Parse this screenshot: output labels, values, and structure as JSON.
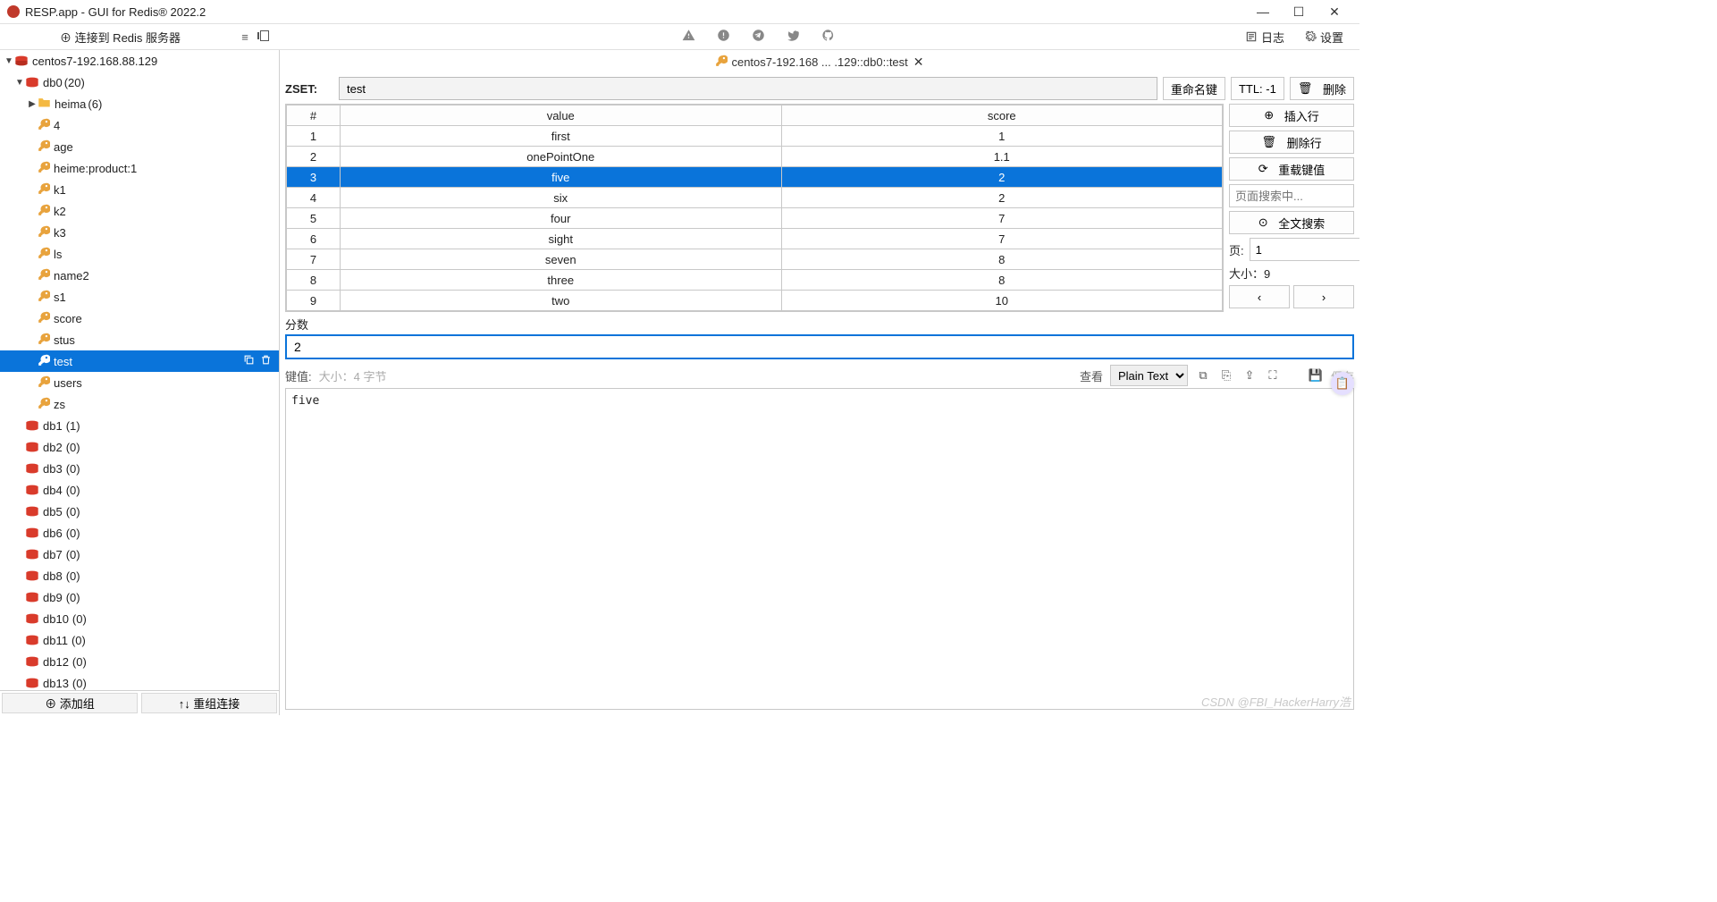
{
  "window": {
    "title": "RESP.app - GUI for Redis® 2022.2"
  },
  "toolbar": {
    "connect_label": "⊕ 连接到 Redis 服务器",
    "log_label": "日志",
    "settings_label": "设置"
  },
  "sidebar": {
    "connection": "centos7-192.168.88.129",
    "db0": {
      "label": "db0",
      "count": "(20)"
    },
    "folder": {
      "label": "heima",
      "count": "(6)"
    },
    "keys": [
      "4",
      "age",
      "heime:product:1",
      "k1",
      "k2",
      "k3",
      "ls",
      "name2",
      "s1",
      "score",
      "stus",
      "test",
      "users",
      "zs"
    ],
    "selected_key": "test",
    "dbs": [
      {
        "name": "db1",
        "count": "(1)"
      },
      {
        "name": "db2",
        "count": "(0)"
      },
      {
        "name": "db3",
        "count": "(0)"
      },
      {
        "name": "db4",
        "count": "(0)"
      },
      {
        "name": "db5",
        "count": "(0)"
      },
      {
        "name": "db6",
        "count": "(0)"
      },
      {
        "name": "db7",
        "count": "(0)"
      },
      {
        "name": "db8",
        "count": "(0)"
      },
      {
        "name": "db9",
        "count": "(0)"
      },
      {
        "name": "db10",
        "count": "(0)"
      },
      {
        "name": "db11",
        "count": "(0)"
      },
      {
        "name": "db12",
        "count": "(0)"
      },
      {
        "name": "db13",
        "count": "(0)"
      }
    ],
    "footer": {
      "add_group": "⊕ 添加组",
      "batch": "↑↓ 重组连接"
    }
  },
  "tab": {
    "title": "centos7-192.168 ... .129::db0::test"
  },
  "keyview": {
    "type_label": "ZSET:",
    "key_name": "test",
    "rename": "重命名键",
    "ttl": "TTL: -1",
    "delete": "删除",
    "columns": {
      "idx": "#",
      "value": "value",
      "score": "score"
    },
    "rows": [
      {
        "i": "1",
        "v": "first",
        "s": "1"
      },
      {
        "i": "2",
        "v": "onePointOne",
        "s": "1.1"
      },
      {
        "i": "3",
        "v": "five",
        "s": "2"
      },
      {
        "i": "4",
        "v": "six",
        "s": "2"
      },
      {
        "i": "5",
        "v": "four",
        "s": "7"
      },
      {
        "i": "6",
        "v": "sight",
        "s": "7"
      },
      {
        "i": "7",
        "v": "seven",
        "s": "8"
      },
      {
        "i": "8",
        "v": "three",
        "s": "8"
      },
      {
        "i": "9",
        "v": "two",
        "s": "10"
      }
    ],
    "selected_row": 2,
    "side": {
      "insert": "插入行",
      "delete": "删除行",
      "reload": "重载键值",
      "search_placeholder": "页面搜索中...",
      "fulltext": "全文搜索",
      "page_label": "页:",
      "page_value": "1",
      "size_label": "大小：9",
      "prev": "‹",
      "next": "›"
    },
    "score_label": "分数",
    "score_value": "2",
    "value_bar": {
      "label": "键值:",
      "meta": "大小：4 字节",
      "view_label": "查看",
      "format": "Plain Text",
      "save": "保存"
    },
    "value_content": "five"
  },
  "watermark": "CSDN @FBI_HackerHarry浩"
}
